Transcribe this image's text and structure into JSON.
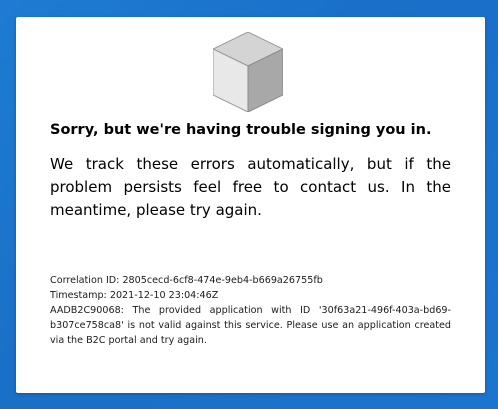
{
  "error_page": {
    "logo_icon": "cube-icon",
    "title": "Sorry, but we're having trouble signing you in.",
    "message": "We track these errors automatically, but if the problem persists feel free to contact us. In the meantime, please try again.",
    "correlation_id": "Correlation ID: 2805cecd-6cf8-474e-9eb4-b669a26755fb",
    "timestamp": "Timestamp: 2021-12-10 23:04:46Z",
    "error_detail": "AADB2C90068: The provided application with ID '30f63a21-496f-403a-bd69-b307ce758ca8' is not valid against this service. Please use an application created via the B2C portal and try again."
  },
  "colors": {
    "background": "#1a6fc7",
    "card": "#ffffff",
    "cube_top": "#cfcfcf",
    "cube_left": "#e6e6e6",
    "cube_right": "#a3a3a3"
  }
}
